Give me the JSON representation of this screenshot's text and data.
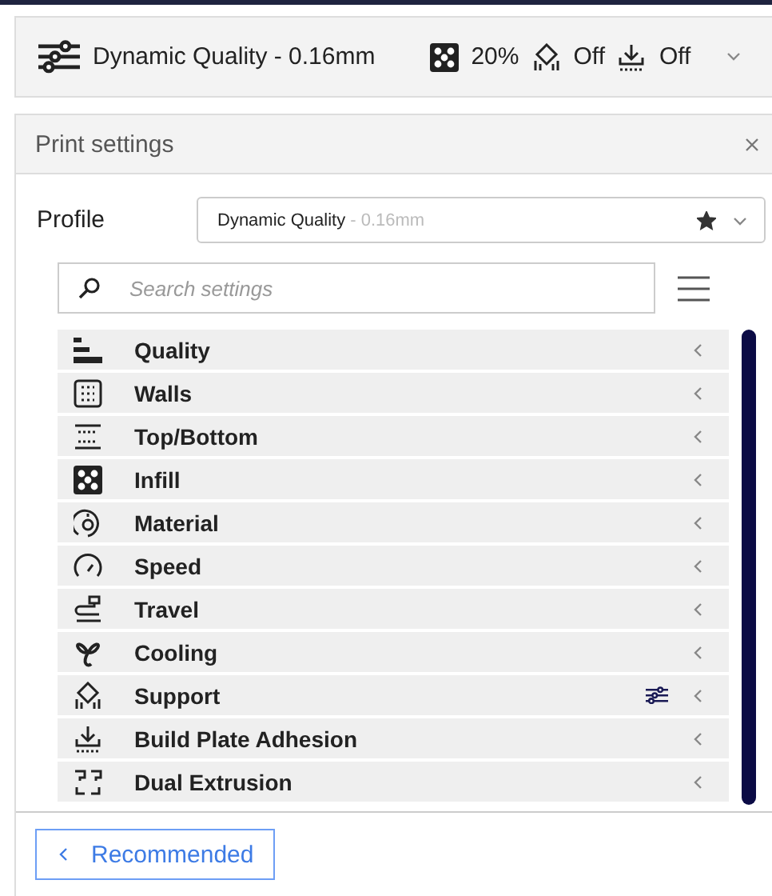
{
  "header": {
    "profile": "Dynamic Quality - 0.16mm",
    "infill": "20%",
    "support": "Off",
    "adhesion": "Off"
  },
  "panel": {
    "title": "Print settings",
    "profile_label": "Profile",
    "profile_name": "Dynamic Quality",
    "profile_suffix": " - 0.16mm",
    "favorite": true,
    "search": {
      "placeholder": "Search settings"
    },
    "categories": [
      {
        "label": "Quality",
        "customized": false
      },
      {
        "label": "Walls",
        "customized": false
      },
      {
        "label": "Top/Bottom",
        "customized": false
      },
      {
        "label": "Infill",
        "customized": false
      },
      {
        "label": "Material",
        "customized": false
      },
      {
        "label": "Speed",
        "customized": false
      },
      {
        "label": "Travel",
        "customized": false
      },
      {
        "label": "Cooling",
        "customized": false
      },
      {
        "label": "Support",
        "customized": true
      },
      {
        "label": "Build Plate Adhesion",
        "customized": false
      },
      {
        "label": "Dual Extrusion",
        "customized": false
      }
    ],
    "footer_button": "Recommended"
  }
}
